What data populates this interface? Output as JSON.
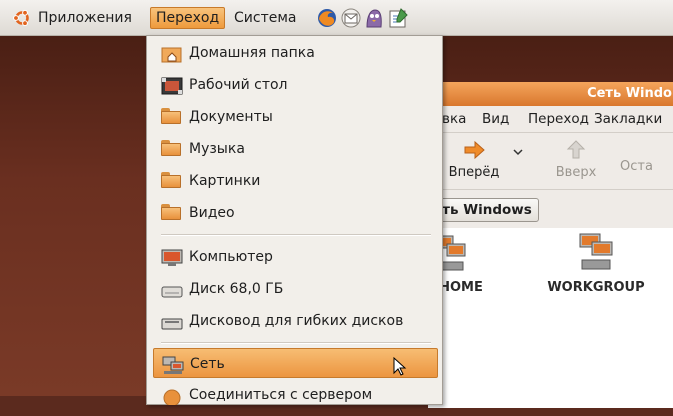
{
  "panel": {
    "menus": [
      {
        "label": "Приложения"
      },
      {
        "label": "Переход"
      },
      {
        "label": "Система"
      }
    ],
    "launchers": [
      "firefox-icon",
      "mail-icon",
      "pidgin-icon",
      "notes-icon"
    ]
  },
  "menu": {
    "items": [
      {
        "label": "Домашняя папка",
        "icon": "home-folder-icon"
      },
      {
        "label": "Рабочий стол",
        "icon": "desktop-icon"
      },
      {
        "label": "Документы",
        "icon": "folder-icon"
      },
      {
        "label": "Музыка",
        "icon": "folder-icon"
      },
      {
        "label": "Картинки",
        "icon": "folder-icon"
      },
      {
        "label": "Видео",
        "icon": "folder-icon"
      },
      {
        "label": "Компьютер",
        "icon": "computer-icon"
      },
      {
        "label": "Диск 68,0 ГБ",
        "icon": "drive-icon"
      },
      {
        "label": "Дисковод для гибких дисков",
        "icon": "floppy-icon"
      },
      {
        "label": "Сеть",
        "icon": "network-icon"
      },
      {
        "label": "Соединиться с сервером",
        "icon": "server-icon"
      }
    ],
    "highlighted_index": 9
  },
  "file_manager": {
    "title": "Сеть Windo",
    "menubar": [
      "вка",
      "Вид",
      "Переход",
      "Закладки"
    ],
    "toolbar": {
      "forward_label": "Вперёд",
      "up_label": "Вверх",
      "stop_label": "Оста"
    },
    "path_button": "еть Windows",
    "items": [
      "HOME",
      "WORKGROUP"
    ]
  },
  "colors": {
    "accent": "#ec9540",
    "panel": "#dedad4",
    "desktop": "#6a2f20"
  }
}
